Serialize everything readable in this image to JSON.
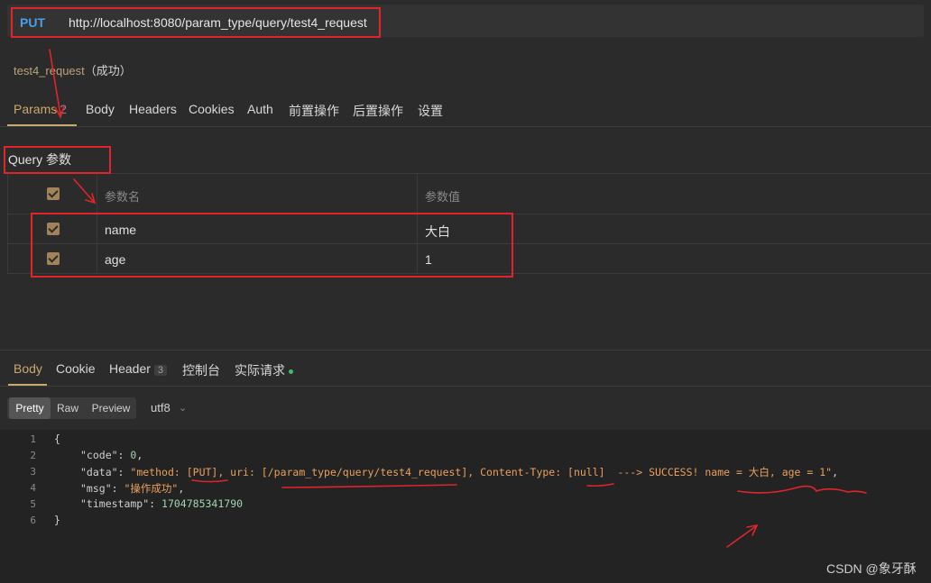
{
  "request": {
    "method": "PUT",
    "url": "http://localhost:8080/param_type/query/test4_request",
    "name": "test4_request",
    "status": "（成功）"
  },
  "request_tabs": [
    {
      "label": "Params",
      "count": "2"
    },
    {
      "label": "Body"
    },
    {
      "label": "Headers"
    },
    {
      "label": "Cookies"
    },
    {
      "label": "Auth"
    },
    {
      "label": "前置操作"
    },
    {
      "label": "后置操作"
    },
    {
      "label": "设置"
    }
  ],
  "query": {
    "title": "Query 参数",
    "columns": [
      "参数名",
      "参数值"
    ],
    "rows": [
      {
        "name": "name",
        "value": "大白"
      },
      {
        "name": "age",
        "value": "1"
      }
    ]
  },
  "response_tabs": [
    {
      "label": "Body"
    },
    {
      "label": "Cookie"
    },
    {
      "label": "Header",
      "count": "3"
    },
    {
      "label": "控制台"
    },
    {
      "label": "实际请求"
    }
  ],
  "format_buttons": [
    "Pretty",
    "Raw",
    "Preview"
  ],
  "encoding": "utf8",
  "code_lines": {
    "numbers": [
      "1",
      "2",
      "3",
      "4",
      "5",
      "6"
    ],
    "open_brace": "{",
    "close_brace": "}",
    "code_key": "\"code\"",
    "code_val": "0",
    "data_key": "\"data\"",
    "data_val": "\"method: [PUT], uri: [/param_type/query/test4_request], Content-Type: [null]  ---> SUCCESS! name = 大白, age = 1\"",
    "msg_key": "\"msg\"",
    "msg_val": "\"操作成功\"",
    "ts_key": "\"timestamp\"",
    "ts_val": "1704785341790"
  },
  "watermark": "CSDN @象牙酥",
  "colors": {
    "accent": "#c9a96e",
    "method": "#4a9fe8",
    "annotation": "#e0242c",
    "string": "#e8a05e",
    "number": "#9fd6b0"
  }
}
